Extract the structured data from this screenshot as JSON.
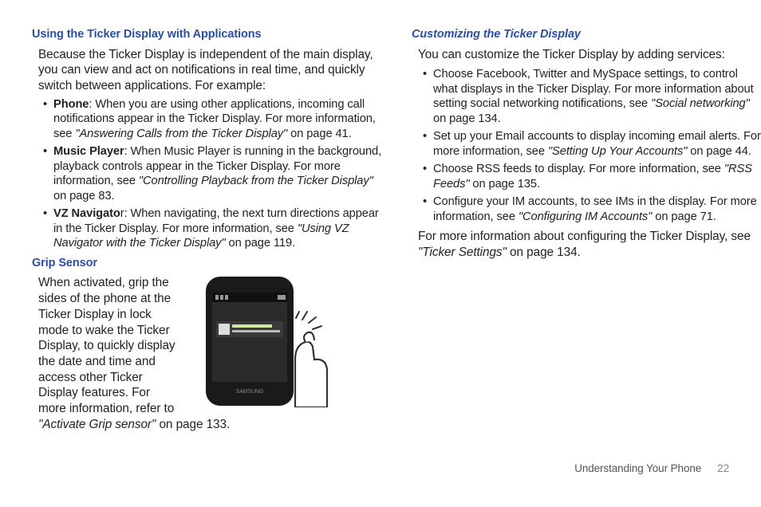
{
  "left": {
    "heading1": "Using the Ticker Display with Applications",
    "intro": "Because the Ticker Display is independent of the main display, you can view and act on notifications in real time, and quickly switch between applications. For example:",
    "items": [
      {
        "lead": "Phone",
        "text": ": When you are using other applications, incoming call notifications appear in the Ticker Display. For more information, see ",
        "quote": "\"Answering Calls from the Ticker Display\"",
        "tail": " on page 41."
      },
      {
        "lead": "Music Player",
        "text": ": When Music Player is running in the background, playback controls appear in the Ticker Display.  For more information, see ",
        "quote": "\"Controlling Playback from the Ticker Display\"",
        "tail": " on page 83."
      },
      {
        "lead": "VZ Navigato",
        "text": "r: When navigating, the next turn directions appear in the Ticker Display. For more information, see ",
        "quote": "\"Using VZ Navigator with the Ticker Display\"",
        "tail": " on page 119."
      }
    ],
    "heading2": "Grip Sensor",
    "gripText": "When activated, grip the sides of the phone at the Ticker Display in lock mode to wake the Ticker Display, to quickly display the date and time and access other Ticker Display features. For more information, refer to",
    "gripQuote": "\"Activate Grip sensor\"",
    "gripTail": "  on page 133."
  },
  "right": {
    "heading": "Customizing the Ticker Display",
    "intro": "You can customize the Ticker Display by adding services:",
    "items": [
      {
        "pre": "Choose Facebook, Twitter and MySpace settings, to control what displays in the Ticker Display.  For more information about setting social networking notifications, see ",
        "quote": "\"Social networking\"",
        "tail": " on page 134."
      },
      {
        "pre": "Set up your Email accounts to display incoming email alerts. For more information, see ",
        "quote": "\"Setting Up Your Accounts\"",
        "tail": " on page 44."
      },
      {
        "pre": "Choose RSS feeds to display. For more information, see ",
        "quote": "\"RSS Feeds\"",
        "tail": " on page 135."
      },
      {
        "pre": "Configure your IM accounts, to see IMs in the display. For more information, see ",
        "quote": "\"Configuring IM Accounts\"",
        "tail": " on page 71."
      }
    ],
    "closingPre": "For more information about configuring the Ticker Display, see ",
    "closingQuote": "\"Ticker Settings\"",
    "closingTail": " on page 134."
  },
  "footer": {
    "section": "Understanding Your Phone",
    "page": "22"
  }
}
